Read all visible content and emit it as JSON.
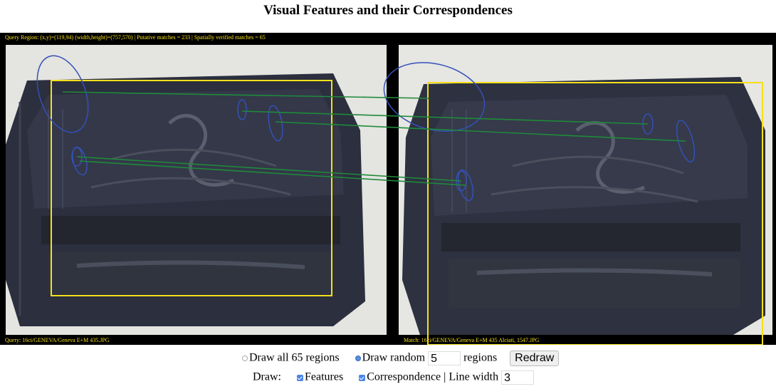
{
  "title": "Visual Features and their Correspondences",
  "info": {
    "query_region": "Query Region: (x,y)=(119,94)  (width,height)=(757,570) | Putative matches = 233 | Spatially verified matches = 65",
    "query_file": "Query: 16ci/GENEVA/Geneva E+M 435.JPG",
    "match_file": "Match: 16ci/GENEVA/Geneva E+M 435 Alciati, 1547.JPG"
  },
  "controls": {
    "draw_all_label": "Draw all 65 regions",
    "draw_random_label": "Draw random",
    "random_count": "5",
    "regions_label": "regions",
    "redraw_label": "Redraw",
    "draw_label": "Draw:",
    "features_label": "Features",
    "correspondence_label": "Correspondence",
    "line_width_label": "| Line width",
    "line_width_value": "3"
  },
  "colors": {
    "region_box": "#f5e01a",
    "feature_ellipse": "#3450b8",
    "correspondence_line": "#1f8a3a",
    "block_dark": "#2a2e3d"
  }
}
